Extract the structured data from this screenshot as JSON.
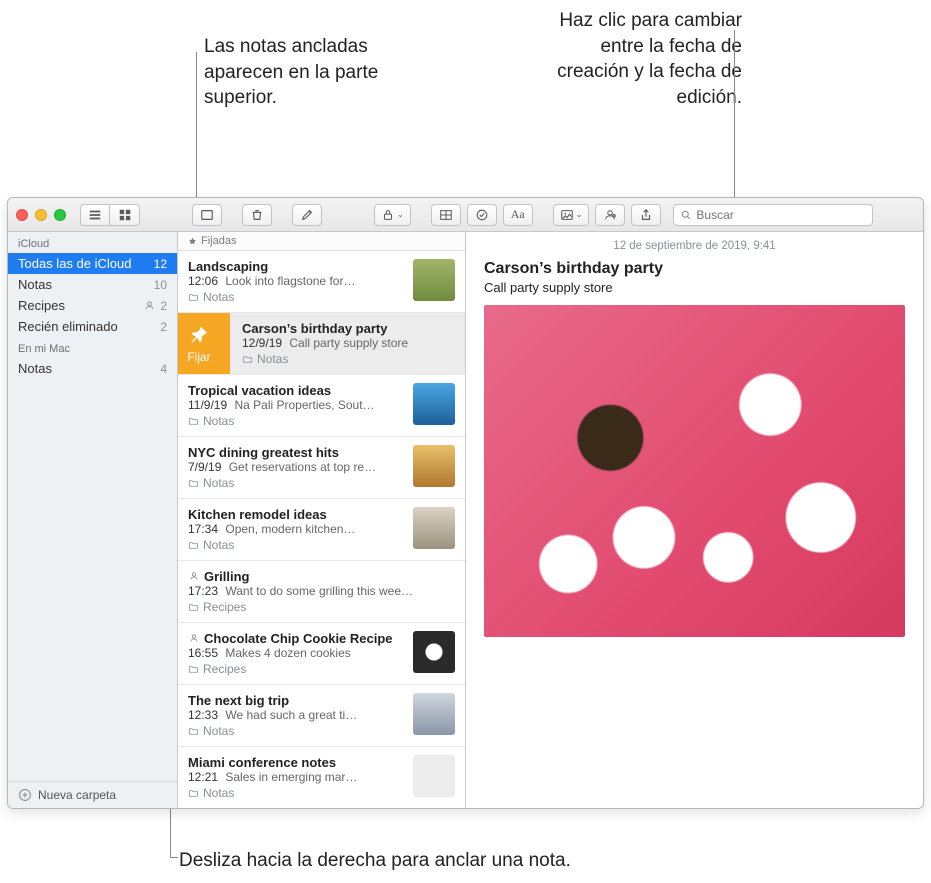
{
  "callouts": {
    "pinned": "Las notas ancladas aparecen en la parte superior.",
    "date": "Haz clic para cambiar entre la fecha de creación y la fecha de edición.",
    "swipe": "Desliza hacia la derecha para anclar una nota."
  },
  "titlebar": {
    "search_placeholder": "Buscar",
    "format_label": "Aa"
  },
  "sidebar": {
    "sections": [
      {
        "title": "iCloud",
        "items": [
          {
            "label": "Todas las de iCloud",
            "count": "12",
            "active": true,
            "shared": false
          },
          {
            "label": "Notas",
            "count": "10",
            "active": false,
            "shared": false
          },
          {
            "label": "Recipes",
            "count": "2",
            "active": false,
            "shared": true
          },
          {
            "label": "Recién eliminado",
            "count": "2",
            "active": false,
            "shared": false
          }
        ]
      },
      {
        "title": "En mi Mac",
        "items": [
          {
            "label": "Notas",
            "count": "4",
            "active": false,
            "shared": false
          }
        ]
      }
    ],
    "new_folder": "Nueva carpeta"
  },
  "pinned_label": "Fijadas",
  "pin_action": "Fijar",
  "notes": [
    {
      "title": "Landscaping",
      "date": "12:06",
      "preview": "Look into flagstone for…",
      "folder": "Notas",
      "thumb": "t1",
      "pinned": true,
      "selected": false,
      "shared": false,
      "show_pin_action": false
    },
    {
      "title": "Carson’s birthday party",
      "date": "12/9/19",
      "preview": "Call party supply store",
      "folder": "Notas",
      "thumb": "",
      "pinned": true,
      "selected": true,
      "shared": false,
      "show_pin_action": true
    },
    {
      "title": "Tropical vacation ideas",
      "date": "11/9/19",
      "preview": "Na Pali Properties, Sout…",
      "folder": "Notas",
      "thumb": "t2",
      "pinned": false,
      "selected": false,
      "shared": false,
      "show_pin_action": false
    },
    {
      "title": "NYC dining greatest hits",
      "date": "7/9/19",
      "preview": "Get reservations at top re…",
      "folder": "Notas",
      "thumb": "t3",
      "pinned": false,
      "selected": false,
      "shared": false,
      "show_pin_action": false
    },
    {
      "title": "Kitchen remodel ideas",
      "date": "17:34",
      "preview": "Open, modern kitchen…",
      "folder": "Notas",
      "thumb": "t4",
      "pinned": false,
      "selected": false,
      "shared": false,
      "show_pin_action": false
    },
    {
      "title": "Grilling",
      "date": "17:23",
      "preview": "Want to do some grilling this wee…",
      "folder": "Recipes",
      "thumb": "",
      "pinned": false,
      "selected": false,
      "shared": true,
      "show_pin_action": false
    },
    {
      "title": "Chocolate Chip Cookie Recipe",
      "date": "16:55",
      "preview": "Makes 4 dozen cookies",
      "folder": "Recipes",
      "thumb": "t5",
      "pinned": false,
      "selected": false,
      "shared": true,
      "show_pin_action": false
    },
    {
      "title": "The next big trip",
      "date": "12:33",
      "preview": "We had such a great ti…",
      "folder": "Notas",
      "thumb": "t6",
      "pinned": false,
      "selected": false,
      "shared": false,
      "show_pin_action": false
    },
    {
      "title": "Miami conference notes",
      "date": "12:21",
      "preview": "Sales in emerging mar…",
      "folder": "Notas",
      "thumb": "t7",
      "pinned": false,
      "selected": false,
      "shared": false,
      "show_pin_action": false
    }
  ],
  "editor": {
    "date": "12 de septiembre de 2019, 9:41",
    "title": "Carson’s birthday party",
    "subtitle": "Call party supply store"
  }
}
